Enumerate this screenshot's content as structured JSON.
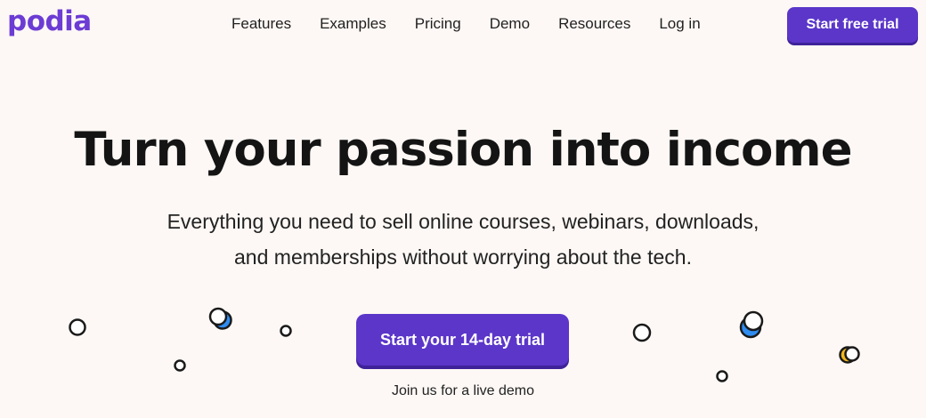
{
  "header": {
    "logo": "podia",
    "nav": [
      "Features",
      "Examples",
      "Pricing",
      "Demo",
      "Resources",
      "Log in"
    ],
    "cta_label": "Start free trial"
  },
  "hero": {
    "title": "Turn your passion into income",
    "subtitle_line1": "Everything you need to sell online courses, webinars, downloads,",
    "subtitle_line2": "and memberships without worrying about the tech.",
    "cta_label": "Start your 14-day trial",
    "demo_link": "Join us for a live demo"
  },
  "colors": {
    "brand": "#5b36c9",
    "logo": "#6c3cd4",
    "background": "#fdf8f5",
    "accent_blue": "#2f8cf0",
    "accent_yellow": "#f2b71c"
  }
}
